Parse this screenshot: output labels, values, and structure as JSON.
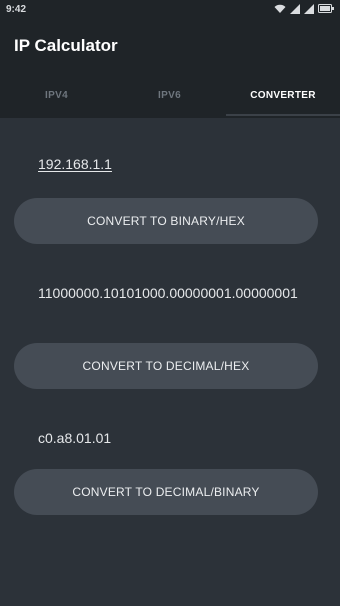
{
  "status_bar": {
    "time": "9:42",
    "icons": [
      "wifi-icon",
      "signal-icon",
      "signal-icon",
      "battery-icon"
    ]
  },
  "app": {
    "title": "IP Calculator"
  },
  "tabs": [
    {
      "label": "IPV4",
      "active": false
    },
    {
      "label": "IPV6",
      "active": false
    },
    {
      "label": "CONVERTER",
      "active": true
    }
  ],
  "converter": {
    "ip_input_value": "192.168.1.1",
    "convert_binary_hex_label": "CONVERT TO BINARY/HEX",
    "binary_result": "11000000.10101000.00000001.00000001",
    "convert_decimal_hex_label": "CONVERT TO DECIMAL/HEX",
    "hex_result": "c0.a8.01.01",
    "convert_decimal_binary_label": "CONVERT TO DECIMAL/BINARY"
  },
  "colors": {
    "background": "#2c3239",
    "appbar": "#1f2428",
    "button": "#454c55",
    "tab_inactive": "#6e767e",
    "tab_active": "#ffffff"
  }
}
